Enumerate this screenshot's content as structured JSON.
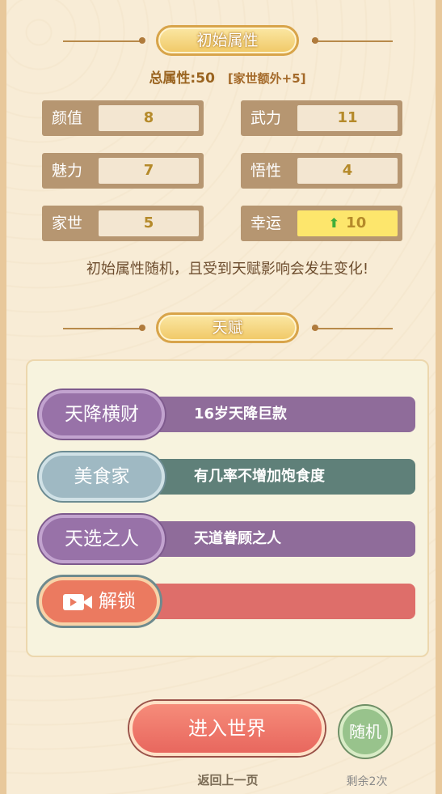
{
  "attributes_section": {
    "title": "初始属性",
    "total_label": "总属性:50",
    "family_bonus": "[家世额外+5]",
    "stats": [
      {
        "label": "颜值",
        "value": "8"
      },
      {
        "label": "武力",
        "value": "11"
      },
      {
        "label": "魅力",
        "value": "7"
      },
      {
        "label": "悟性",
        "value": "4"
      },
      {
        "label": "家世",
        "value": "5"
      },
      {
        "label": "幸运",
        "value": "10",
        "boosted": true,
        "icon": "green-up-arrow-icon"
      }
    ],
    "note": "初始属性随机，且受到天赋影响会发生变化!"
  },
  "talent_section": {
    "title": "天赋",
    "talents": [
      {
        "name": "天降横财",
        "desc": "16岁天降巨款",
        "color": "#8f6c9a"
      },
      {
        "name": "美食家",
        "desc": "有几率不增加饱食度",
        "color": "#5f8079"
      },
      {
        "name": "天选之人",
        "desc": "天道眷顾之人",
        "color": "#8f6c9a"
      }
    ],
    "unlock": {
      "label": "解锁",
      "icon": "video-camera-icon",
      "color": "#de6e6a"
    }
  },
  "footer": {
    "enter_label": "进入世界",
    "random_label": "随机",
    "back_label": "返回上一页",
    "remaining_label": "剩余2次"
  }
}
